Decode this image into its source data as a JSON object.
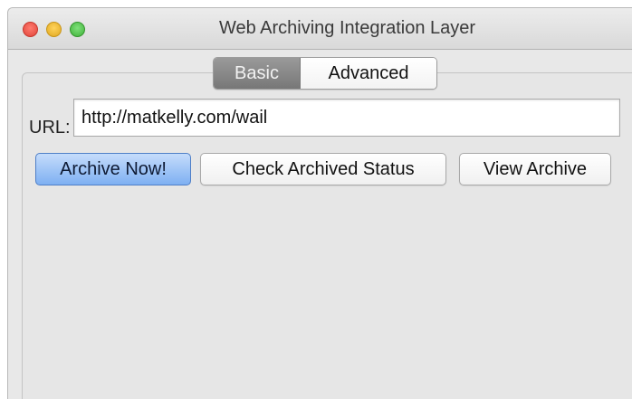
{
  "window": {
    "title": "Web Archiving Integration Layer"
  },
  "tabs": [
    {
      "label": "Basic",
      "selected": true
    },
    {
      "label": "Advanced",
      "selected": false
    }
  ],
  "url_field": {
    "label": "URL:",
    "value": "http://matkelly.com/wail"
  },
  "buttons": {
    "archive_now": "Archive Now!",
    "check_status": "Check Archived Status",
    "view_archive": "View Archive"
  },
  "colors": {
    "window_bg": "#e8e8e8",
    "default_button": "#7eb0f2",
    "selected_tab": "#777777",
    "close": "#e0443a",
    "minimize": "#e0a821",
    "zoom": "#3fb23a"
  },
  "icons": {
    "close": "close-icon",
    "minimize": "minimize-icon",
    "zoom": "zoom-icon"
  }
}
